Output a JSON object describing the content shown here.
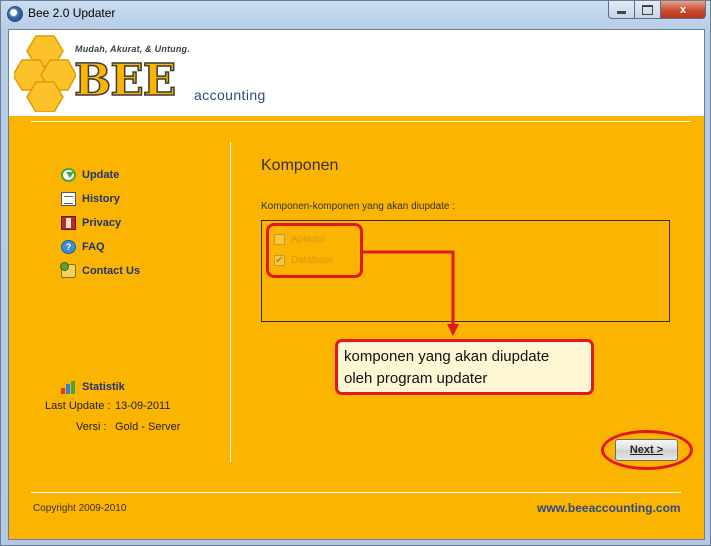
{
  "window": {
    "title": "Bee 2.0 Updater",
    "controls": {
      "minimize": "",
      "maximize": "",
      "close": "x"
    }
  },
  "logo": {
    "tagline": "Mudah, Akurat, & Untung.",
    "brand": "BEE",
    "suffix": "accounting"
  },
  "nav": {
    "items": [
      {
        "label": "Update",
        "icon": "update-icon"
      },
      {
        "label": "History",
        "icon": "history-icon"
      },
      {
        "label": "Privacy",
        "icon": "privacy-icon"
      },
      {
        "label": "FAQ",
        "icon": "faq-icon"
      },
      {
        "label": "Contact Us",
        "icon": "contact-icon"
      }
    ]
  },
  "stats": {
    "title": "Statistik",
    "last_update_label": "Last Update :",
    "last_update_value": "13-09-2011",
    "version_label": "Versi :",
    "version_value": "Gold - Server"
  },
  "panel": {
    "title": "Komponen",
    "subtitle": "Komponen-komponen yang akan diupdate :",
    "components": [
      {
        "label": "Aplikasi",
        "checked": false
      },
      {
        "label": "Database",
        "checked": true
      }
    ]
  },
  "annotation": {
    "callout_line1": "komponen yang akan diupdate",
    "callout_line2": "oleh program updater",
    "color": "#e3171f"
  },
  "buttons": {
    "next": "Next >"
  },
  "footer": {
    "copyright": "Copyright 2009-2010",
    "website": "www.beeaccounting.com"
  },
  "colors": {
    "accent": "#fbb400",
    "nav_text": "#21346d",
    "link": "#2d4a84"
  }
}
